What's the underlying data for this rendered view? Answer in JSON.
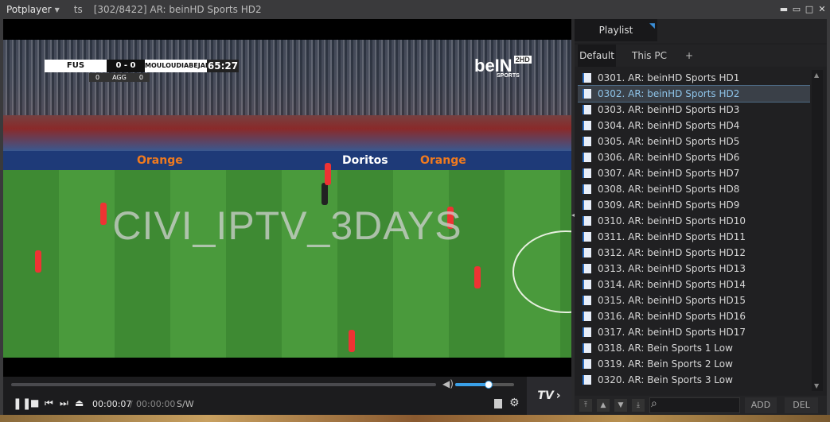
{
  "titlebar": {
    "app_name": "Potplayer",
    "format": "ts",
    "title": "[302/8422] AR: beinHD Sports HD2"
  },
  "video": {
    "watermark": "CIVI_IPTV_3DAYS",
    "scoreboard": {
      "home": "FUS",
      "score": "0 - 0",
      "away": "MOULOUDIABEJAIA",
      "time": "65:27",
      "agg_left": "0",
      "agg_label": "AGG",
      "agg_right": "0"
    },
    "channel_logo": "beIN",
    "channel_badge": "2HD",
    "channel_sub": "SPORTS",
    "board_orange_1": "Orange",
    "board_doritos": "Doritos",
    "board_orange_2": "Orange"
  },
  "controls": {
    "time_current": "00:00:07",
    "time_sep": "/",
    "time_total": "00:00:00",
    "sw_label": "S/W",
    "tv_label": "TV",
    "volume_fraction": 0.55
  },
  "playlist": {
    "panel_title": "Playlist",
    "tabs": {
      "default": "Default",
      "this_pc": "This PC",
      "add": "+"
    },
    "items": [
      "0301. AR: beinHD Sports HD1",
      "0302. AR: beinHD Sports HD2",
      "0303. AR: beinHD Sports HD3",
      "0304. AR: beinHD Sports HD4",
      "0305. AR: beinHD Sports HD5",
      "0306. AR: beinHD Sports HD6",
      "0307. AR: beinHD Sports HD7",
      "0308. AR: beinHD Sports HD8",
      "0309. AR: beinHD Sports HD9",
      "0310. AR: beinHD Sports HD10",
      "0311. AR: beinHD Sports HD11",
      "0312. AR: beinHD Sports HD12",
      "0313. AR: beinHD Sports HD13",
      "0314. AR: beinHD Sports HD14",
      "0315. AR: beinHD Sports HD15",
      "0316. AR: beinHD Sports HD16",
      "0317. AR: beinHD Sports HD17",
      "0318. AR: Bein Sports 1 Low",
      "0319. AR: Bein Sports 2 Low",
      "0320. AR: Bein Sports 3 Low"
    ],
    "active_index": 1,
    "add_label": "ADD",
    "del_label": "DEL"
  },
  "colors": {
    "accent": "#3aa0e8",
    "active_text": "#8ec3e8"
  }
}
